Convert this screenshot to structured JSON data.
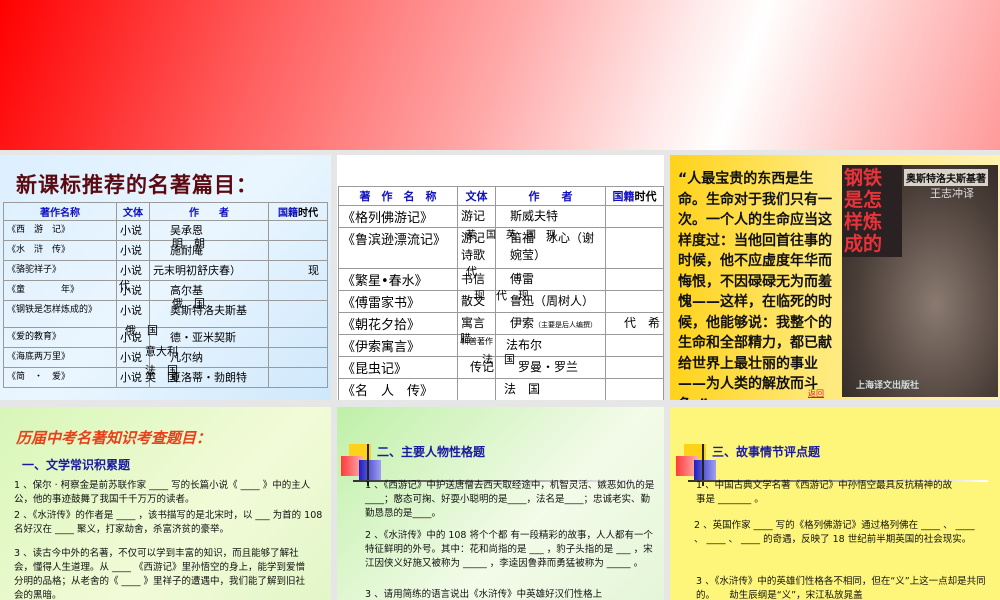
{
  "panel1": {
    "title": "新课标推荐的名著篇目：",
    "headers": [
      "著作名称",
      "文体",
      "作　　者",
      "国籍",
      "时代"
    ],
    "rows": [
      {
        "name": "《西　游　记》",
        "genre": "小说",
        "author": "吴承恩",
        "extra": ""
      },
      {
        "name": "《水　浒　传》",
        "genre": "小说",
        "author": "施耐庵",
        "extra": "明　朝"
      },
      {
        "name": "《骆驼祥子》",
        "genre": "小说",
        "author": "元末明初舒庆春）",
        "extra": "现"
      },
      {
        "name": "《童　　　　年》",
        "genre": "小说",
        "author": "高尔基",
        "extra": "代"
      },
      {
        "name": "《钢铁是怎样炼成的》",
        "genre": "小说",
        "author": "奥斯特洛夫斯基",
        "extra": "俄　国"
      },
      {
        "name": "《爱的教育》",
        "genre": "小说",
        "author": "德・亚米契斯",
        "extra": "俄　国"
      },
      {
        "name": "《海底两万里》",
        "genre": "小说",
        "author": "凡尔纳",
        "extra": "意大利"
      },
      {
        "name": "《简　・　爱》",
        "genre": "小说",
        "author": "夏洛蒂・勃朗特",
        "extra": "法　国"
      }
    ],
    "tail": "英　国"
  },
  "panel2": {
    "headers": [
      "著　作　名　称",
      "文体",
      "作　　者",
      "国籍",
      "时代"
    ],
    "rows": [
      {
        "name": "《格列佛游记》",
        "genre": "游记",
        "author": "斯威夫特",
        "extra": ""
      },
      {
        "name": "《鲁滨逊漂流记》",
        "genre": "游记　诗歌",
        "author": "笛福　冰心（谢婉莹）",
        "extra": "英　国　英　国　现"
      },
      {
        "name": "《繁星•春水》",
        "genre": "书信",
        "author": "傅雷",
        "extra": "代"
      },
      {
        "name": "《傅雷家书》",
        "genre": "散文",
        "author": "鲁迅（周树人）",
        "extra": "现　代　现"
      },
      {
        "name": "《朝花夕拾》",
        "genre": "寓言",
        "author": "伊索",
        "note": "（主要是后人编撰）",
        "extra": "代　希"
      },
      {
        "name": "《伊索寓言》",
        "genre": "科普著作",
        "author": "法布尔",
        "extra": "腊"
      },
      {
        "name": "《昆虫记》",
        "genre": "传记",
        "author": "罗曼・罗兰",
        "extra": "法　国"
      },
      {
        "name": "《名　人　传》",
        "genre": "",
        "author": "法　国",
        "extra": ""
      }
    ]
  },
  "panel3": {
    "quote": "“人最宝贵的东西是生命。生命对于我们只有一次。一个人的生命应当这样度过：当他回首往事的时候，他不应虚度年华而悔恨，不因碌碌无为而羞愧——这样，在临死的时候，他能够说：我整个的生命和全部精力，都已献给世界上最壮丽的事业——为人类的解放而斗争。”",
    "cover_title": "钢铁是怎样炼成的",
    "cover_author": "奥斯特洛夫斯基著",
    "cover_translator": "王志冲译",
    "cover_publisher": "上海译文出版社",
    "back_link": "返回"
  },
  "panel4": {
    "title": "历届中考名著知识考查题目：",
    "section": "一、文学常识积累题",
    "q1": "1 、保尔 · 柯察金是前苏联作家 ____ 写的长篇小说《 ____ 》中的主人公，他的事迹鼓舞了我国千千万万的读者。",
    "q2": "2 、《水浒传》的作者是 ____ ，该书描写的是北宋时，以 ___ 为首的 108 名好汉在 ____ 聚义，打家劫舍，杀富济贫的豪举。",
    "q3": "3 、读古今中外的名著，不仅可以学到丰富的知识，而且能够了解社会，懂得人生道理。从 ____ 《西游记》里孙悟空的身上，能学到爱憎分明的品格；从老舍的《 ____ 》里祥子的遭遇中，我们能了解到旧社会的黑暗。"
  },
  "panel5": {
    "section": "二、主要人物性格题",
    "q1": "1 、《西游记》中护送唐僧去西天取经途中，机智灵活、嫉恶如仇的是____；憨态可掬、好耍小聪明的是____，法名是____；忠诚老实、勤勤恳恳的是____。",
    "q2": "2 、《水浒传》中的 108 将个个都 有一段精彩的故事，人人都有一个特征鲜明的外号。其中：花和尚指的是 ___ ，豹子头指的是 ___ ，宋江因侠义好施又被称为 _____ ，李逵因鲁莽而勇猛被称为 _____ 。",
    "q3": "3 、请用简练的语言说出《水浒传》中英雄好汉们性格上"
  },
  "panel6": {
    "section": "三、故事情节评点题",
    "q1": "1 、中国古典文学名著《西游记》中孙悟空最具反抗精神的故事是 _______ 。",
    "q2": "2 、英国作家 ____ 写的《格列佛游记》通过格列佛在 ____ 、 ____ 、 ____ 、 ____ 的奇遇，反映了 18 世纪前半期英国的社会现实。",
    "q3": "3 、《水浒传》中的英雄们性格各不相同，但在“义”上这一点却是共同的。　　劫生辰纲是“义”，宋江私放晁盖"
  }
}
